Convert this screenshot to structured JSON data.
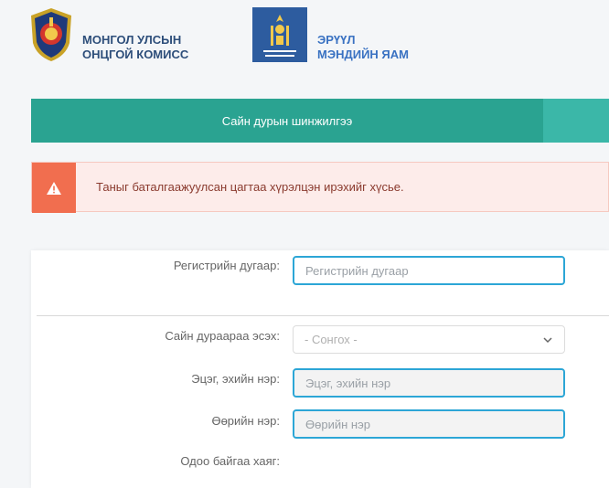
{
  "header": {
    "org1_line1": "МОНГОЛ УЛСЫН",
    "org1_line2": "ОНЦГОЙ КОМИСС",
    "org2_line1": "ЭРҮҮЛ",
    "org2_line2": "МЭНДИЙН ЯАМ"
  },
  "tabs": [
    {
      "label": "Сайн дурын шинжилгээ"
    }
  ],
  "alert": {
    "text": "Таныг баталгаажуулсан цагтаа хүрэлцэн ирэхийг хүсье.",
    "icon": "warning-icon",
    "color": "#f16e4f"
  },
  "form": {
    "registration": {
      "label": "Регистрийн дугаар:",
      "placeholder": "Регистрийн дугаар"
    },
    "voluntary": {
      "label": "Сайн дураараа эсэх:",
      "value": "- Сонгох -"
    },
    "surname": {
      "label": "Эцэг, эхийн нэр:",
      "placeholder": "Эцэг, эхийн нэр"
    },
    "firstname": {
      "label": "Өөрийн нэр:",
      "placeholder": "Өөрийн нэр"
    },
    "address": {
      "label": "Одоо байгаа хаяг:"
    }
  },
  "colors": {
    "accent": "#2aa391",
    "input_border": "#2ca6d6",
    "title_blue": "#2d4e7a"
  }
}
